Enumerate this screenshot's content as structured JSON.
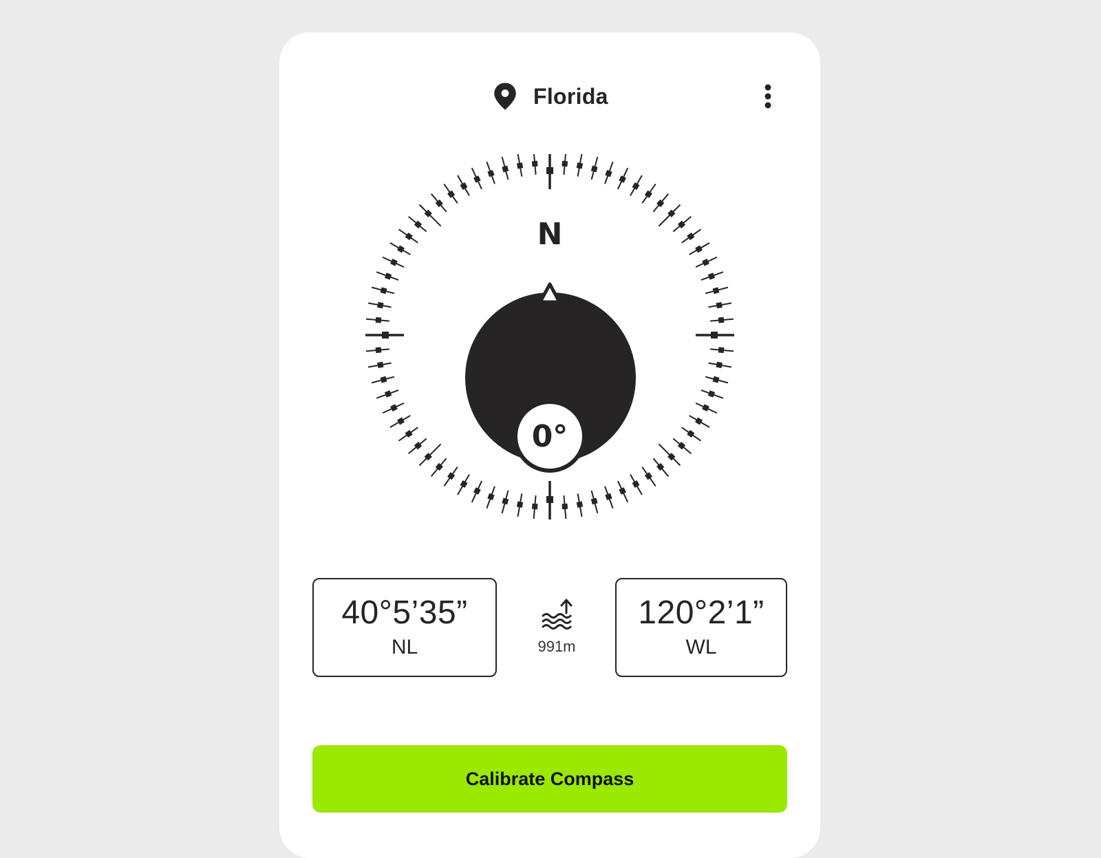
{
  "header": {
    "location": "Florida",
    "location_icon": "map-pin-icon",
    "menu_icon": "more-vertical-icon"
  },
  "compass": {
    "north_label": "N",
    "heading": "0°",
    "heading_degrees": 0
  },
  "coordinates": {
    "latitude": {
      "value": "40°5’35”",
      "direction": "NL"
    },
    "longitude": {
      "value": "120°2’1”",
      "direction": "WL"
    },
    "altitude": {
      "value": "991m",
      "icon": "sea-level-altitude-icon"
    }
  },
  "actions": {
    "calibrate_label": "Calibrate Compass"
  },
  "colors": {
    "background": "#ebebeb",
    "card": "#ffffff",
    "ink": "#262424",
    "accent": "#9be800"
  }
}
